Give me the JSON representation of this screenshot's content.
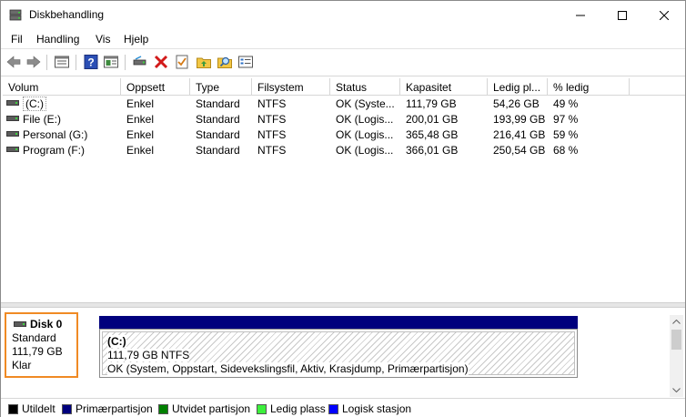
{
  "window": {
    "title": "Diskbehandling"
  },
  "menu": [
    "Fil",
    "Handling",
    "Vis",
    "Hjelp"
  ],
  "toolbar": {
    "icons": [
      "back-arrow-icon",
      "forward-arrow-icon",
      "properties-icon",
      "help-icon",
      "console-icon",
      "connect-drive-icon",
      "delete-icon",
      "check-icon",
      "open-folder-icon",
      "find-icon",
      "settings-icon"
    ]
  },
  "volumes": {
    "columns": [
      "Volum",
      "Oppsett",
      "Type",
      "Filsystem",
      "Status",
      "Kapasitet",
      "Ledig pl...",
      "% ledig"
    ],
    "rows": [
      [
        "(C:)",
        "Enkel",
        "Standard",
        "NTFS",
        "OK (Syste...",
        "111,79 GB",
        "54,26 GB",
        "49 %"
      ],
      [
        "File (E:)",
        "Enkel",
        "Standard",
        "NTFS",
        "OK (Logis...",
        "200,01 GB",
        "193,99 GB",
        "97 %"
      ],
      [
        "Personal (G:)",
        "Enkel",
        "Standard",
        "NTFS",
        "OK (Logis...",
        "365,48 GB",
        "216,41 GB",
        "59 %"
      ],
      [
        "Program (F:)",
        "Enkel",
        "Standard",
        "NTFS",
        "OK (Logis...",
        "366,01 GB",
        "250,54 GB",
        "68 %"
      ]
    ]
  },
  "disk": {
    "name": "Disk 0",
    "type": "Standard",
    "size": "111,79 GB",
    "state": "Klar",
    "partition": {
      "name": "(C:)",
      "size_fs": "111,79 GB NTFS",
      "status": "OK (System, Oppstart, Sidevekslingsfil, Aktiv, Krasjdump, Primærpartisjon)"
    }
  },
  "legend": [
    {
      "label": "Utildelt",
      "color": "#000000"
    },
    {
      "label": "Primærpartisjon",
      "color": "#00007d"
    },
    {
      "label": "Utvidet partisjon",
      "color": "#008000"
    },
    {
      "label": "Ledig plass",
      "color": "#3cf03c"
    },
    {
      "label": "Logisk stasjon",
      "color": "#0000ff"
    }
  ]
}
